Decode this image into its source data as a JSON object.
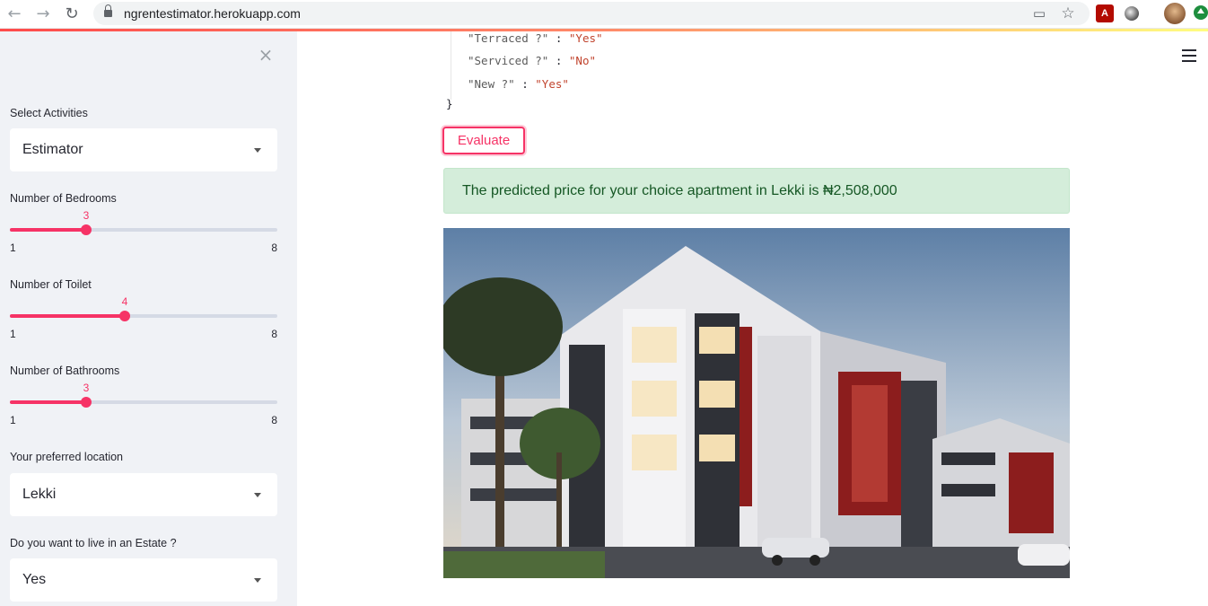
{
  "browser": {
    "url": "ngrentestimator.herokuapp.com",
    "icons": [
      "back-arrow-icon",
      "forward-arrow-icon",
      "reload-icon",
      "lock-icon",
      "cast-icon",
      "star-icon",
      "pdf-extension-icon",
      "extension-icon",
      "profile-avatar",
      "update-icon"
    ]
  },
  "sidebar": {
    "close_glyph": "×",
    "activities": {
      "label": "Select Activities",
      "value": "Estimator"
    },
    "bedrooms": {
      "label": "Number of Bedrooms",
      "value": 3,
      "min": 1,
      "max": 8,
      "value_text": "3",
      "min_text": "1",
      "max_text": "8"
    },
    "toilets": {
      "label": "Number of Toilet",
      "value": 4,
      "min": 1,
      "max": 8,
      "value_text": "4",
      "min_text": "1",
      "max_text": "8"
    },
    "bathrooms": {
      "label": "Number of Bathrooms",
      "value": 3,
      "min": 1,
      "max": 8,
      "value_text": "3",
      "min_text": "1",
      "max_text": "8"
    },
    "location": {
      "label": "Your preferred location",
      "value": "Lekki"
    },
    "estate": {
      "label": "Do you want to live in an Estate ?",
      "value": "Yes"
    }
  },
  "main": {
    "json_lines": [
      {
        "key": "\"Terraced ?\"",
        "colon": " : ",
        "value": "\"Yes\""
      },
      {
        "key": "\"Serviced ?\"",
        "colon": " : ",
        "value": "\"No\""
      },
      {
        "key": "\"New ?\"",
        "colon": " : ",
        "value": "\"Yes\""
      }
    ],
    "json_close": "}",
    "evaluate_label": "Evaluate",
    "result_text": "The predicted price for your choice apartment in Lekki is ₦2,508,000"
  },
  "colors": {
    "accent": "#f63366",
    "sidebar_bg": "#f0f2f6",
    "success_bg": "#d4edda",
    "success_text": "#155724"
  }
}
